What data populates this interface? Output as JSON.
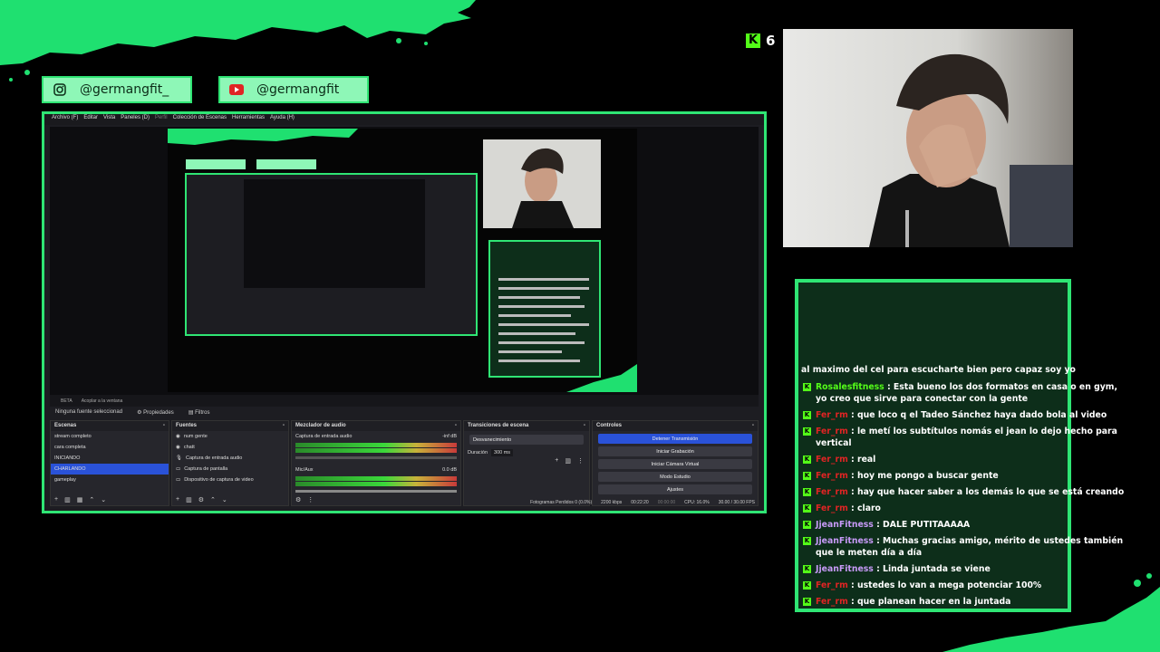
{
  "brand_color": "#2fe574",
  "kick": {
    "logo_letter": "K",
    "viewer_count": "6"
  },
  "socials": [
    {
      "icon": "instagram-icon",
      "handle": "@germangfit_"
    },
    {
      "icon": "youtube-icon",
      "handle": "@germangfit"
    }
  ],
  "obs": {
    "menu": [
      "Archivo (F)",
      "Editar",
      "Vista",
      "Paneles (D)",
      "Perfil",
      "Colección de Escenas",
      "Herramientas",
      "Ayuda (H)"
    ],
    "preview_bar": [
      "BETA",
      "Acoplar a la ventana"
    ],
    "source_bar": {
      "none_selected": "Ninguna fuente seleccionad",
      "properties": "Propiedades",
      "filters": "Filtros"
    },
    "scenes": {
      "title": "Escenas",
      "items": [
        "stream completo",
        "cara completa",
        "INICIANDO",
        "CHARLANDO",
        "gameplay"
      ],
      "selected_index": 3
    },
    "sources": {
      "title": "Fuentes",
      "items": [
        "num gente",
        "chatt",
        "Captura de entrada audio",
        "Captura de pantalla",
        "Dispositivo de captura de video"
      ]
    },
    "mixer": {
      "title": "Mezclador de audio",
      "channels": [
        {
          "name": "Captura de entrada audio",
          "db": "-inf dB"
        },
        {
          "name": "Mic/Aux",
          "db": "0.0 dB"
        }
      ]
    },
    "transitions": {
      "title": "Transiciones de escena",
      "selected": "Desvanecimiento",
      "duration_label": "Duración",
      "duration_value": "300 ms"
    },
    "controls": {
      "title": "Controles",
      "buttons": [
        "Detener Transmisión",
        "Iniciar Grabación",
        "Iniciar Cámara Virtual",
        "Modo Estudio",
        "Ajustes"
      ]
    },
    "status": {
      "dropped": "Fotogramas Perdidos 0 (0.0%)",
      "bitrate": "2200 kbps",
      "live_time": "00:22:20",
      "rec_time": "00:00:00",
      "cpu": "CPU: 16.0%",
      "fps": "30.00 / 30.00 FPS"
    }
  },
  "chat": {
    "colors": {
      "Rosalesfitness": "#53fc18",
      "Fer_rm": "#e02424",
      "JjeanFitness": "#c79af7"
    },
    "partial_first_line": "al maximo del cel para escucharte bien pero capaz soy yo",
    "messages": [
      {
        "user": "Rosalesfitness",
        "color": "#53fc18",
        "text": "Esta bueno los dos formatos en casa o en gym, yo creo que sirve para conectar con la gente"
      },
      {
        "user": "Fer_rm",
        "color": "#e02424",
        "text": "que loco q el Tadeo Sánchez haya dado bola al video"
      },
      {
        "user": "Fer_rm",
        "color": "#e02424",
        "text": "le metí los subtítulos nomás el jean lo dejo hecho para vertical"
      },
      {
        "user": "Fer_rm",
        "color": "#e02424",
        "text": "real"
      },
      {
        "user": "Fer_rm",
        "color": "#e02424",
        "text": "hoy me pongo a buscar gente"
      },
      {
        "user": "Fer_rm",
        "color": "#e02424",
        "text": "hay que hacer saber a los demás lo que se está creando"
      },
      {
        "user": "Fer_rm",
        "color": "#e02424",
        "text": "claro"
      },
      {
        "user": "JjeanFitness",
        "color": "#c79af7",
        "text": "DALE PUTITAAAAA"
      },
      {
        "user": "JjeanFitness",
        "color": "#c79af7",
        "text": "Muchas gracias amigo, mérito de ustedes también que le meten día a día"
      },
      {
        "user": "JjeanFitness",
        "color": "#c79af7",
        "text": "Linda juntada se viene"
      },
      {
        "user": "Fer_rm",
        "color": "#e02424",
        "text": "ustedes lo van a mega potenciar 100%"
      },
      {
        "user": "Fer_rm",
        "color": "#e02424",
        "text": "que planean hacer en la juntada"
      }
    ]
  }
}
